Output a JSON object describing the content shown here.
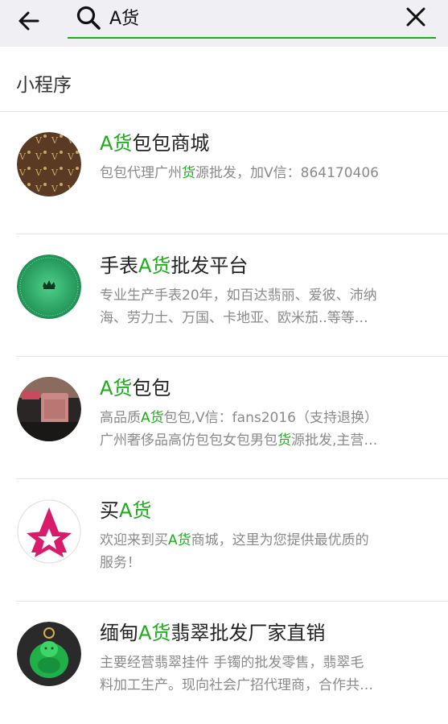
{
  "search": {
    "value": "A货"
  },
  "section_title": "小程序",
  "colors": {
    "accent": "#1aad19",
    "header_bg": "#efeff4"
  },
  "results": [
    {
      "name": [
        "",
        "A货",
        "包包商城"
      ],
      "desc_lines": [
        [
          "包包代理广州",
          "货",
          "源批发，加V信：864170406"
        ]
      ],
      "icon": "lv-monogram-avatar"
    },
    {
      "name": [
        "手表",
        "A货",
        "批发平台"
      ],
      "desc_lines": [
        [
          "专业生产手表20年，如百达翡丽、爱彼、沛纳"
        ],
        [
          "海、劳力士、万国、卡地亚、欧米茄..等等…"
        ]
      ],
      "icon": "rolex-green-dial-avatar"
    },
    {
      "name": [
        "",
        "A货",
        "包包"
      ],
      "desc_lines": [
        [
          "高品质",
          "A货",
          "包包,V信：fans2016（支持退换）"
        ],
        [
          "广州奢侈品高仿包包女包男包",
          "货",
          "源批发,主营…"
        ]
      ],
      "icon": "handbag-photo-avatar"
    },
    {
      "name": [
        "买",
        "A货",
        ""
      ],
      "desc_lines": [
        [
          "欢迎来到买",
          "A货",
          "商城，这里为您提供最优质的"
        ],
        [
          "服务！"
        ]
      ],
      "icon": "pink-star-logo-avatar"
    },
    {
      "name": [
        "缅甸",
        "A货",
        "翡翠批发厂家直销"
      ],
      "desc_lines": [
        [
          "主要经营翡翠挂件 手镯的批发零售，翡翠毛"
        ],
        [
          "料加工生产。现向社会广招代理商，合作共…"
        ]
      ],
      "icon": "jade-buddha-avatar"
    }
  ]
}
